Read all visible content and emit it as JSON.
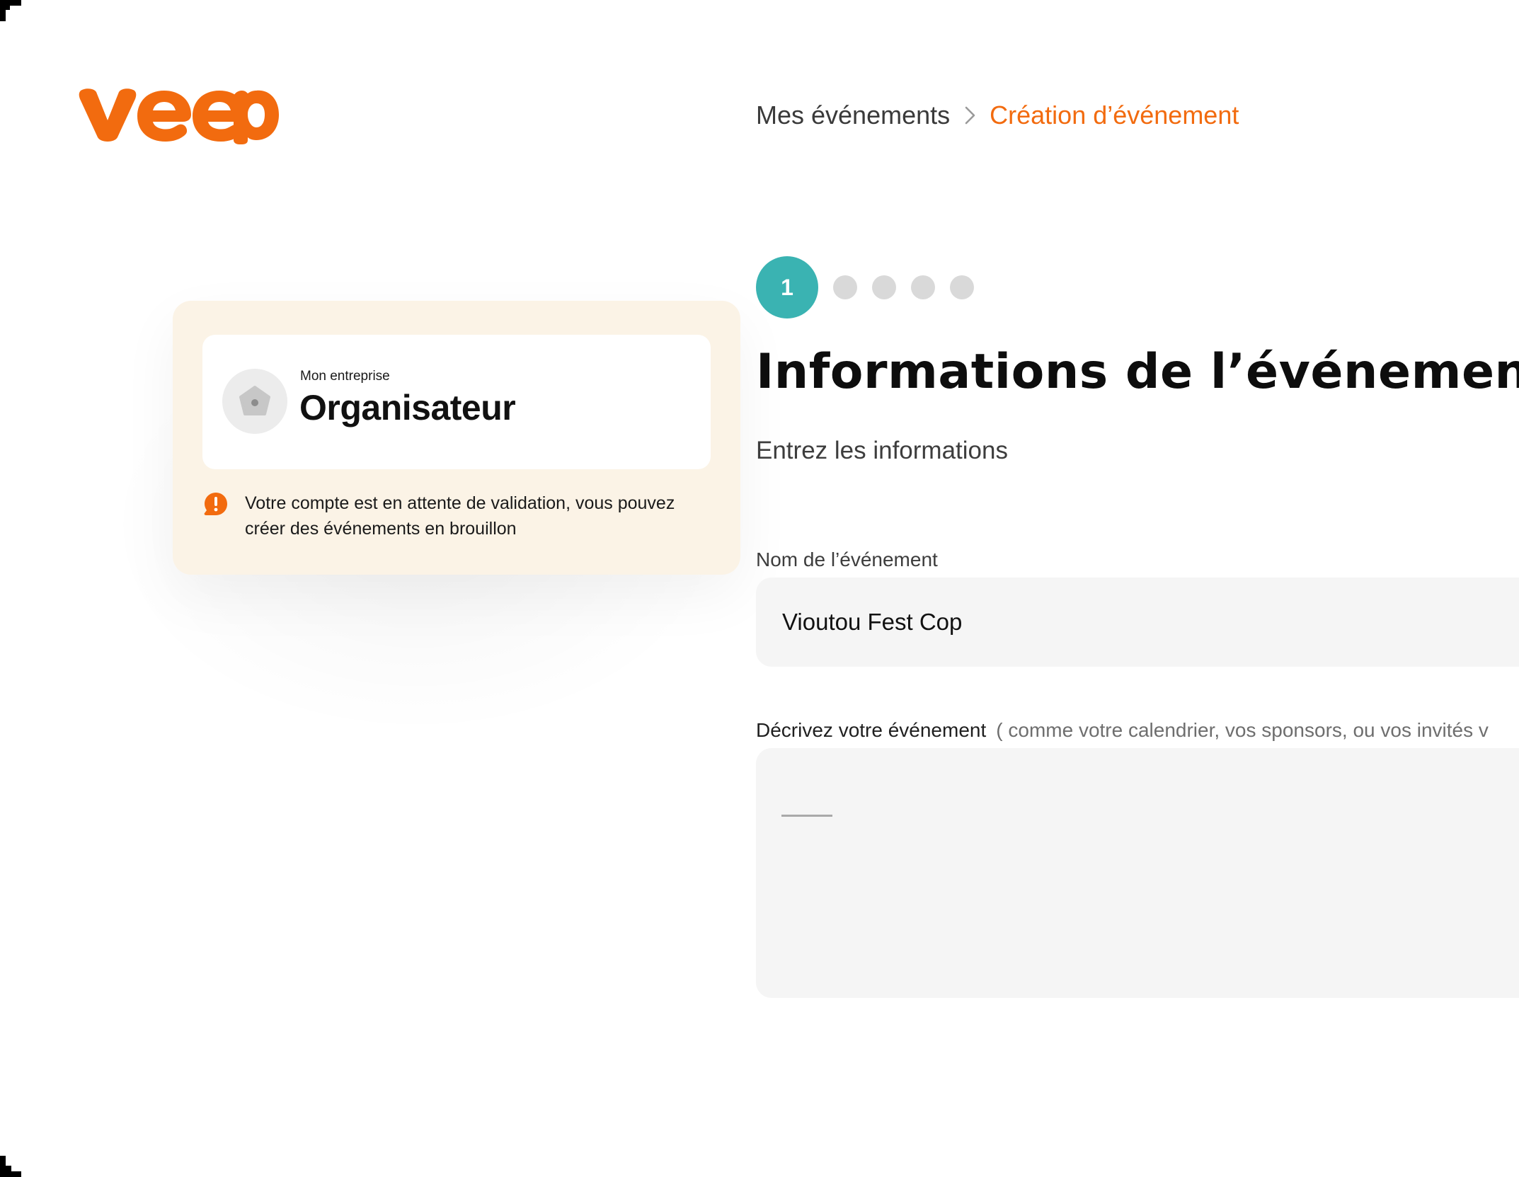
{
  "brand": {
    "logo_text": "veep",
    "accent_color": "#f26b0f",
    "teal_color": "#3ab3b2"
  },
  "breadcrumb": {
    "parent": "Mes événements",
    "current": "Création d’événement"
  },
  "organizer_card": {
    "company": "Mon entreprise",
    "role": "Organisateur",
    "warning": "Votre compte est en attente de validation, vous pouvez créer des événements en brouillon"
  },
  "stepper": {
    "current_step": "1",
    "total_steps": 5
  },
  "form": {
    "title": "Informations de l’événement",
    "subtitle": "Entrez les informations",
    "name_label": "Nom de l’événement",
    "name_value": "Vioutou Fest Cop",
    "description_label": "Décrivez votre événement",
    "description_hint": "( comme votre calendrier, vos sponsors, ou vos invités v",
    "description_value": ""
  }
}
